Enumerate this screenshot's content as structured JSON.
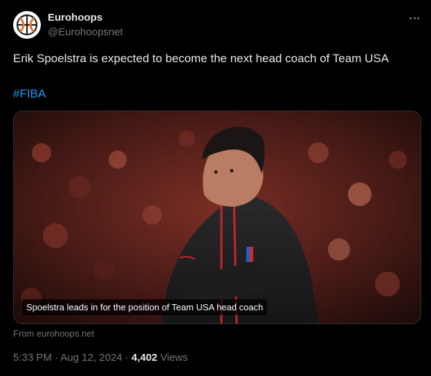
{
  "author": {
    "display_name": "Eurohoops",
    "handle": "@Eurohoopsnet",
    "avatar_icon": "basketball-logo-icon"
  },
  "more_icon": "more-horizontal-icon",
  "tweet": {
    "text": "Erik Spoelstra is expected to become the next head coach of Team USA",
    "hashtag": "#FIBA"
  },
  "media": {
    "caption": "Spoelstra leads in for the position of Team USA head coach",
    "source": "From eurohoops.net"
  },
  "meta": {
    "time": "5:33 PM",
    "separator1": " · ",
    "date": "Aug 12, 2024",
    "separator2": " · ",
    "views_count": "4,402",
    "views_label": " Views"
  },
  "colors": {
    "background": "#000000",
    "text": "#e7e9ea",
    "secondary": "#71767b",
    "link": "#1d9bf0",
    "logo_orange": "#e8722c"
  }
}
